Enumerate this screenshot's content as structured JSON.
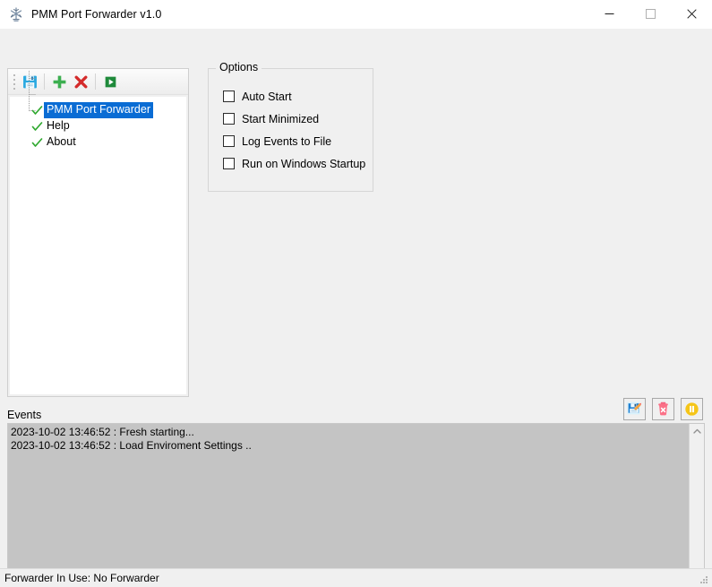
{
  "window": {
    "title": "PMM Port Forwarder v1.0",
    "app_icon": "app-snowflake-icon",
    "minimize_label": "Minimize",
    "maximize_label": "Maximize",
    "close_label": "Close"
  },
  "toolbar": {
    "grip": "drag-grip",
    "buttons": [
      {
        "name": "save-icon",
        "tooltip": "Save"
      },
      {
        "name": "add-icon",
        "tooltip": "Add"
      },
      {
        "name": "delete-icon",
        "tooltip": "Delete"
      },
      {
        "name": "start-icon",
        "tooltip": "Start"
      }
    ]
  },
  "tree": {
    "items": [
      {
        "label": "PMM Port Forwarder",
        "selected": true,
        "check": "green-check-icon"
      },
      {
        "label": "Help",
        "selected": false,
        "check": "green-check-icon"
      },
      {
        "label": "About",
        "selected": false,
        "check": "green-check-icon"
      }
    ]
  },
  "options": {
    "title": "Options",
    "checkboxes": [
      {
        "label": "Auto Start",
        "checked": false
      },
      {
        "label": "Start Minimized",
        "checked": false
      },
      {
        "label": "Log Events to File",
        "checked": false
      },
      {
        "label": "Run on Windows Startup",
        "checked": false
      }
    ]
  },
  "events": {
    "label": "Events",
    "lines": [
      "2023-10-02 13:46:52 : Fresh starting...",
      "2023-10-02 13:46:52 : Load Enviroment Settings .."
    ],
    "buttons": [
      {
        "name": "save-log-icon",
        "tooltip": "Save Log"
      },
      {
        "name": "clear-log-icon",
        "tooltip": "Clear Log"
      },
      {
        "name": "pause-log-icon",
        "tooltip": "Pause Log"
      }
    ],
    "scroll_up": "scroll-up-icon",
    "scroll_down": "scroll-down-icon"
  },
  "status": {
    "text": "Forwarder In Use: No Forwarder"
  },
  "colors": {
    "selection_blue": "#0a6cd4",
    "check_green": "#2fa82f",
    "delete_red": "#d42b2b",
    "add_green": "#3caf50",
    "start_green": "#1f8a3b",
    "pause_yellow": "#f5c518",
    "events_bg": "#c4c4c4",
    "window_bg": "#f0f0f0"
  }
}
